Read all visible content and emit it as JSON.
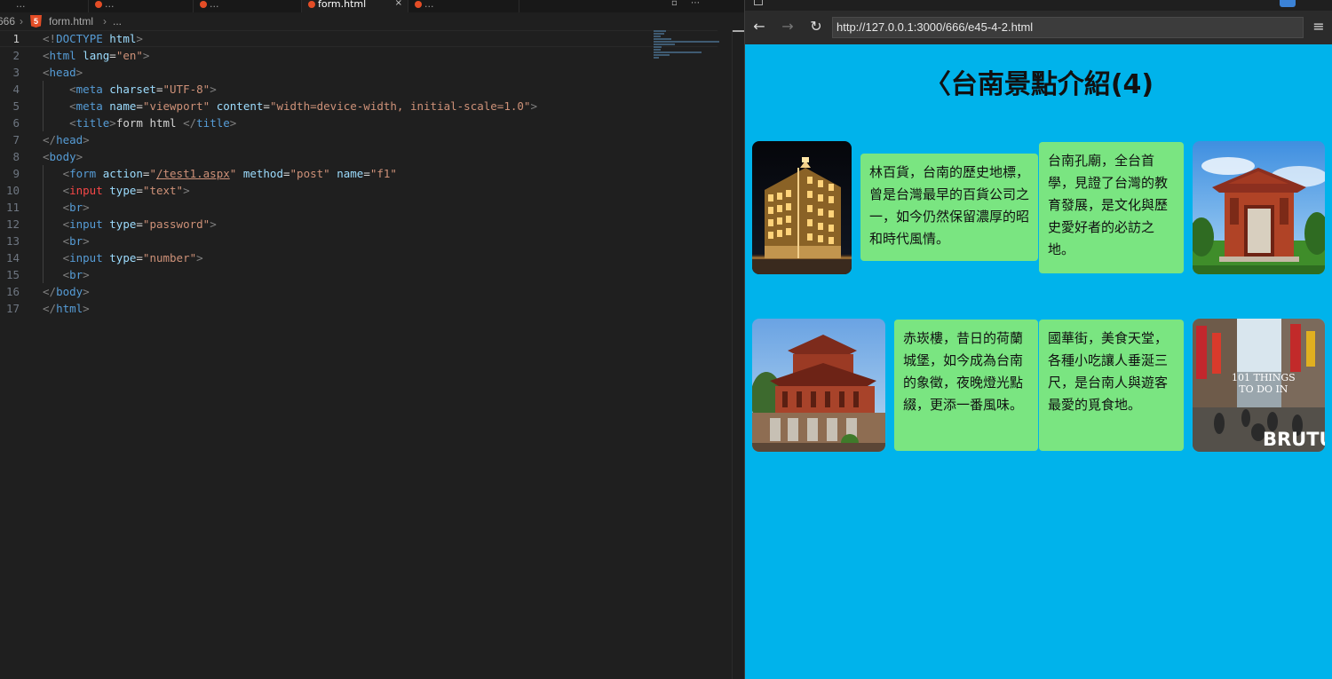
{
  "editor": {
    "tabs": [
      {
        "label": "...",
        "active": false
      },
      {
        "label": "...",
        "active": false
      },
      {
        "label": "...",
        "active": false
      },
      {
        "label": "form.html",
        "active": true
      },
      {
        "label": "...",
        "active": false
      }
    ],
    "breadcrumb": {
      "folder": "666",
      "file": "form.html",
      "rest": "..."
    },
    "line_numbers": [
      "1",
      "2",
      "3",
      "4",
      "5",
      "6",
      "7",
      "8",
      "9",
      "10",
      "11",
      "12",
      "13",
      "14",
      "15",
      "16",
      "17"
    ],
    "current_line": "1",
    "code": {
      "l1": {
        "a": "<!",
        "b": "DOCTYPE",
        "c": "html",
        "d": ">"
      },
      "l2": {
        "a": "<",
        "b": "html",
        "c": "lang",
        "d": "=",
        "e": "\"en\"",
        "f": ">"
      },
      "l3": {
        "a": "<",
        "b": "head",
        "c": ">"
      },
      "l4": {
        "a": "<",
        "b": "meta",
        "c": "charset",
        "d": "=",
        "e": "\"UTF-8\"",
        "f": ">"
      },
      "l5": {
        "a": "<",
        "b": "meta",
        "c": "name",
        "d": "=",
        "e": "\"viewport\"",
        "g": "content",
        "h": "=",
        "i": "\"width=device-width, initial-scale=1.0\"",
        "f": ">"
      },
      "l6": {
        "a": "<",
        "b": "title",
        "c": ">",
        "d": "form html ",
        "e": "</",
        "f": "title",
        "g": ">"
      },
      "l7": {
        "a": "</",
        "b": "head",
        "c": ">"
      },
      "l8": {
        "a": "<",
        "b": "body",
        "c": ">"
      },
      "l9": {
        "a": "<",
        "b": "form",
        "c": "action",
        "d": "=",
        "e": "\"",
        "e2": "/test1.aspx",
        "e3": "\"",
        "g": "method",
        "h": "=",
        "i": "\"post\"",
        "j": "name",
        "k": "=",
        "l": "\"f1\""
      },
      "l10": {
        "a": "<",
        "b": "input",
        "c": "type",
        "d": "=",
        "e": "\"text\"",
        "f": ">"
      },
      "l11": {
        "a": "<",
        "b": "br",
        "c": ">"
      },
      "l12": {
        "a": "<",
        "b": "input",
        "c": "type",
        "d": "=",
        "e": "\"password\"",
        "f": ">"
      },
      "l13": {
        "a": "<",
        "b": "br",
        "c": ">"
      },
      "l14": {
        "a": "<",
        "b": "input",
        "c": "type",
        "d": "=",
        "e": "\"number\"",
        "f": ">"
      },
      "l15": {
        "a": "<",
        "b": "br",
        "c": ">"
      },
      "l16": {
        "a": "</",
        "b": "body",
        "c": ">"
      },
      "l17": {
        "a": "</",
        "b": "html",
        "c": ">"
      }
    }
  },
  "browser": {
    "nav": {
      "back": "←",
      "forward": "→",
      "reload": "↻",
      "menu": "≡"
    },
    "url": "http://127.0.0.1:3000/666/e45-4-2.html",
    "page_title": "〈台南景點介紹(4)",
    "cards": [
      {
        "text": "林百貨，台南的歷史地標，曾是台灣最早的百貨公司之一，如今仍然保留濃厚的昭和時代風情。"
      },
      {
        "text": "台南孔廟，全台首學，見證了台灣的教育發展，是文化與歷史愛好者的必訪之地。"
      },
      {
        "text": "赤崁樓，昔日的荷蘭城堡，如今成為台南的象徵，夜晚燈光點綴，更添一番風味。"
      },
      {
        "text": "國華街，美食天堂，各種小吃讓人垂涎三尺，是台南人與遊客最愛的覓食地。"
      }
    ],
    "photo4_overlay": {
      "line1": "101 THINGS",
      "line2": "TO DO IN",
      "brand": "BRUTU"
    }
  },
  "colors": {
    "page_bg": "#00b3eb",
    "card_bg": "#7ae581",
    "editor_bg": "#1f1f1f"
  }
}
